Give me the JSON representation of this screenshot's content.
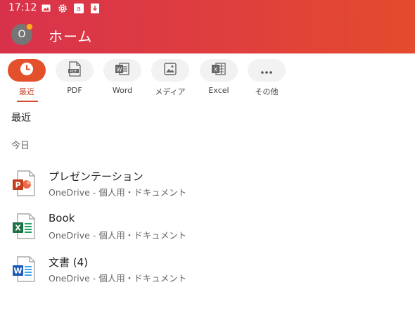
{
  "status_bar": {
    "time": "17:12",
    "icons": [
      "image-icon",
      "settings-icon",
      "amazon-icon",
      "download-icon"
    ]
  },
  "header": {
    "avatar_initial": "O",
    "title": "ホーム",
    "colors": {
      "gradient_start": "#d8324b",
      "gradient_end": "#e44b2c",
      "notification_dot": "#f6b21b"
    }
  },
  "filters": [
    {
      "label": "最近",
      "icon": "clock-icon",
      "active": true
    },
    {
      "label": "PDF",
      "icon": "pdf-icon",
      "active": false
    },
    {
      "label": "Word",
      "icon": "word-icon",
      "active": false
    },
    {
      "label": "メディア",
      "icon": "image-icon",
      "active": false
    },
    {
      "label": "Excel",
      "icon": "excel-icon",
      "active": false
    },
    {
      "label": "その他",
      "icon": "more-icon",
      "active": false
    }
  ],
  "section": {
    "title": "最近",
    "group_label": "今日"
  },
  "files": [
    {
      "name": "プレゼンテーション",
      "location": "OneDrive - 個人用・ドキュメント",
      "type": "powerpoint",
      "icon": "powerpoint-icon",
      "color": "#c43e1c"
    },
    {
      "name": "Book",
      "location": "OneDrive - 個人用・ドキュメント",
      "type": "excel",
      "icon": "excel-icon",
      "color": "#1e7145"
    },
    {
      "name": "文書 (4)",
      "location": "OneDrive - 個人用・ドキュメント",
      "type": "word",
      "icon": "word-icon",
      "color": "#1f5bb8"
    }
  ]
}
